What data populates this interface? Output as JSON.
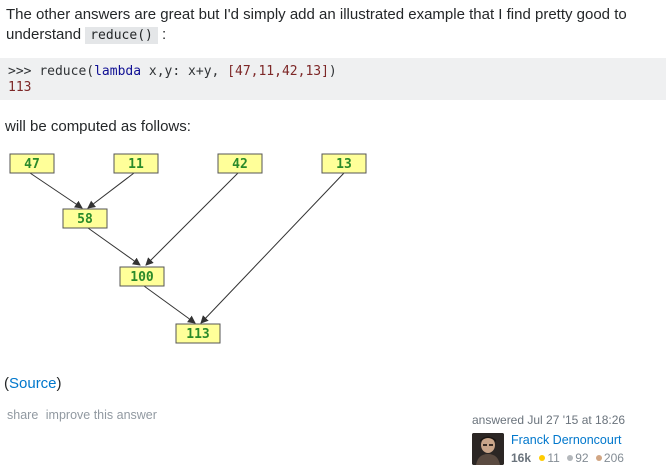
{
  "intro": {
    "text_before": "The other answers are great but I'd simply add an illustrated example that I find pretty good to understand ",
    "code": "reduce()",
    "text_after": " :"
  },
  "code_block": {
    "line1": {
      "prompt": ">>> ",
      "fn": "reduce(",
      "kw": "lambda",
      "args": " x,y: x+y, ",
      "list": "[47,11,42,13]",
      "close": ")"
    },
    "line2": "113"
  },
  "computed_text": "will be computed as follows:",
  "diagram": {
    "nodes": [
      "47",
      "11",
      "42",
      "13",
      "58",
      "100",
      "113"
    ],
    "colors": {
      "node_fill": "#ffff99",
      "node_border": "#555555",
      "node_text": "#2a8a2a",
      "edge": "#333333"
    }
  },
  "source": {
    "open": "(",
    "link": "Source",
    "close": ")"
  },
  "post_menu": {
    "share": "share",
    "improve": "improve this answer"
  },
  "answer_info": {
    "action_time": "answered Jul 27 '15 at 18:26",
    "user_name": "Franck Dernoncourt",
    "reputation": "16k",
    "badges": {
      "gold": "11",
      "silver": "92",
      "bronze": "206"
    },
    "badge_colors": {
      "gold": "#ffcc01",
      "silver": "#b4b8bc",
      "bronze": "#d1a684"
    },
    "link_color": "#0077cc"
  }
}
